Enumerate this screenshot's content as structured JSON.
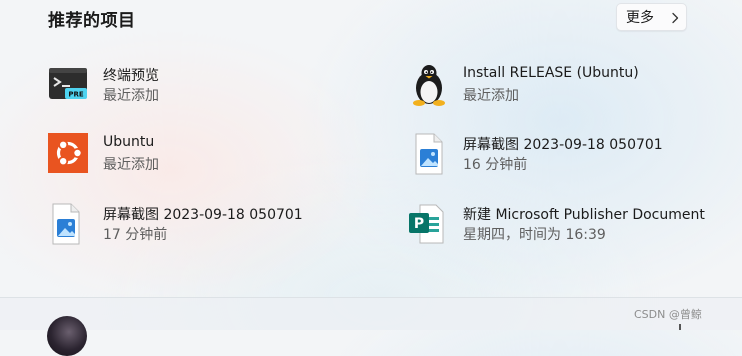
{
  "section": {
    "title": "推荐的项目",
    "more_label": "更多"
  },
  "items": [
    {
      "name": "终端预览",
      "subtitle": "最近添加",
      "icon": "terminal-preview-icon",
      "badge": "PRE"
    },
    {
      "name": "Install RELEASE (Ubuntu)",
      "subtitle": "最近添加",
      "icon": "linux-penguin-icon"
    },
    {
      "name": "Ubuntu",
      "subtitle": "最近添加",
      "icon": "ubuntu-icon",
      "color": "#e95420"
    },
    {
      "name": "屏幕截图 2023-09-18 050701",
      "subtitle": "16 分钟前",
      "icon": "image-file-icon"
    },
    {
      "name": "屏幕截图 2023-09-18 050701",
      "subtitle": "17 分钟前",
      "icon": "image-file-icon"
    },
    {
      "name": "新建 Microsoft Publisher Document",
      "subtitle": "星期四，时间为 16:39",
      "icon": "publisher-file-icon",
      "color": "#077568"
    }
  ],
  "footer": {
    "watermark": "CSDN @曾鲸"
  },
  "colors": {
    "ubuntu_orange": "#e95420",
    "publisher_teal": "#077568",
    "image_blue": "#2b7fd6"
  }
}
